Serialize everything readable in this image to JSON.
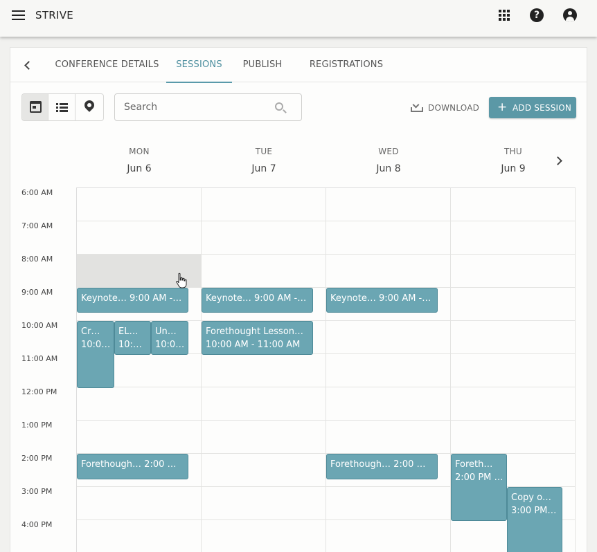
{
  "app": {
    "title": "STRIVE"
  },
  "tabs": [
    {
      "label": "CONFERENCE DETAILS"
    },
    {
      "label": "SESSIONS",
      "active": true
    },
    {
      "label": "PUBLISH"
    },
    {
      "label": "REGISTRATIONS"
    }
  ],
  "view_modes": [
    "calendar-icon",
    "list-icon",
    "map-pin-icon"
  ],
  "active_view": "calendar",
  "search": {
    "placeholder": "Search",
    "value": ""
  },
  "toolbar": {
    "download_label": "DOWNLOAD",
    "add_session_label": "ADD SESSION"
  },
  "colors": {
    "accent": "#5b98a6",
    "event_bg": "#6ba6b3",
    "hover_cell": "#e2e2e0"
  },
  "days": [
    {
      "dow": "MON",
      "date": "Jun 6"
    },
    {
      "dow": "TUE",
      "date": "Jun 7"
    },
    {
      "dow": "WED",
      "date": "Jun 8"
    },
    {
      "dow": "THU",
      "date": "Jun 9"
    }
  ],
  "times": [
    "6:00 AM",
    "7:00 AM",
    "8:00 AM",
    "9:00 AM",
    "10:00 AM",
    "11:00 AM",
    "12:00 PM",
    "1:00 PM",
    "2:00 PM",
    "3:00 PM",
    "4:00 PM"
  ],
  "events": [
    {
      "day": "MON",
      "line1": "Keynote…  9:00 AM -…",
      "line2": ""
    },
    {
      "day": "TUE",
      "line1": "Keynote…  9:00 AM -…",
      "line2": ""
    },
    {
      "day": "WED",
      "line1": "Keynote…  9:00 AM -…",
      "line2": ""
    },
    {
      "day": "MON",
      "line1": "Cr…",
      "line2": "10:0…"
    },
    {
      "day": "MON",
      "line1": "EL…",
      "line2": "10:0…"
    },
    {
      "day": "MON",
      "line1": "Un…",
      "line2": "10:0…"
    },
    {
      "day": "TUE",
      "line1": "Forethought Lesson…",
      "line2": "10:00 AM - 11:00 AM"
    },
    {
      "day": "MON",
      "line1": "Forethough…  2:00 …",
      "line2": ""
    },
    {
      "day": "WED",
      "line1": "Forethough…  2:00 …",
      "line2": ""
    },
    {
      "day": "THU",
      "line1": "Foreth…",
      "line2": "2:00 PM …"
    },
    {
      "day": "THU",
      "line1": "Copy o…",
      "line2": "3:00 PM …"
    }
  ]
}
